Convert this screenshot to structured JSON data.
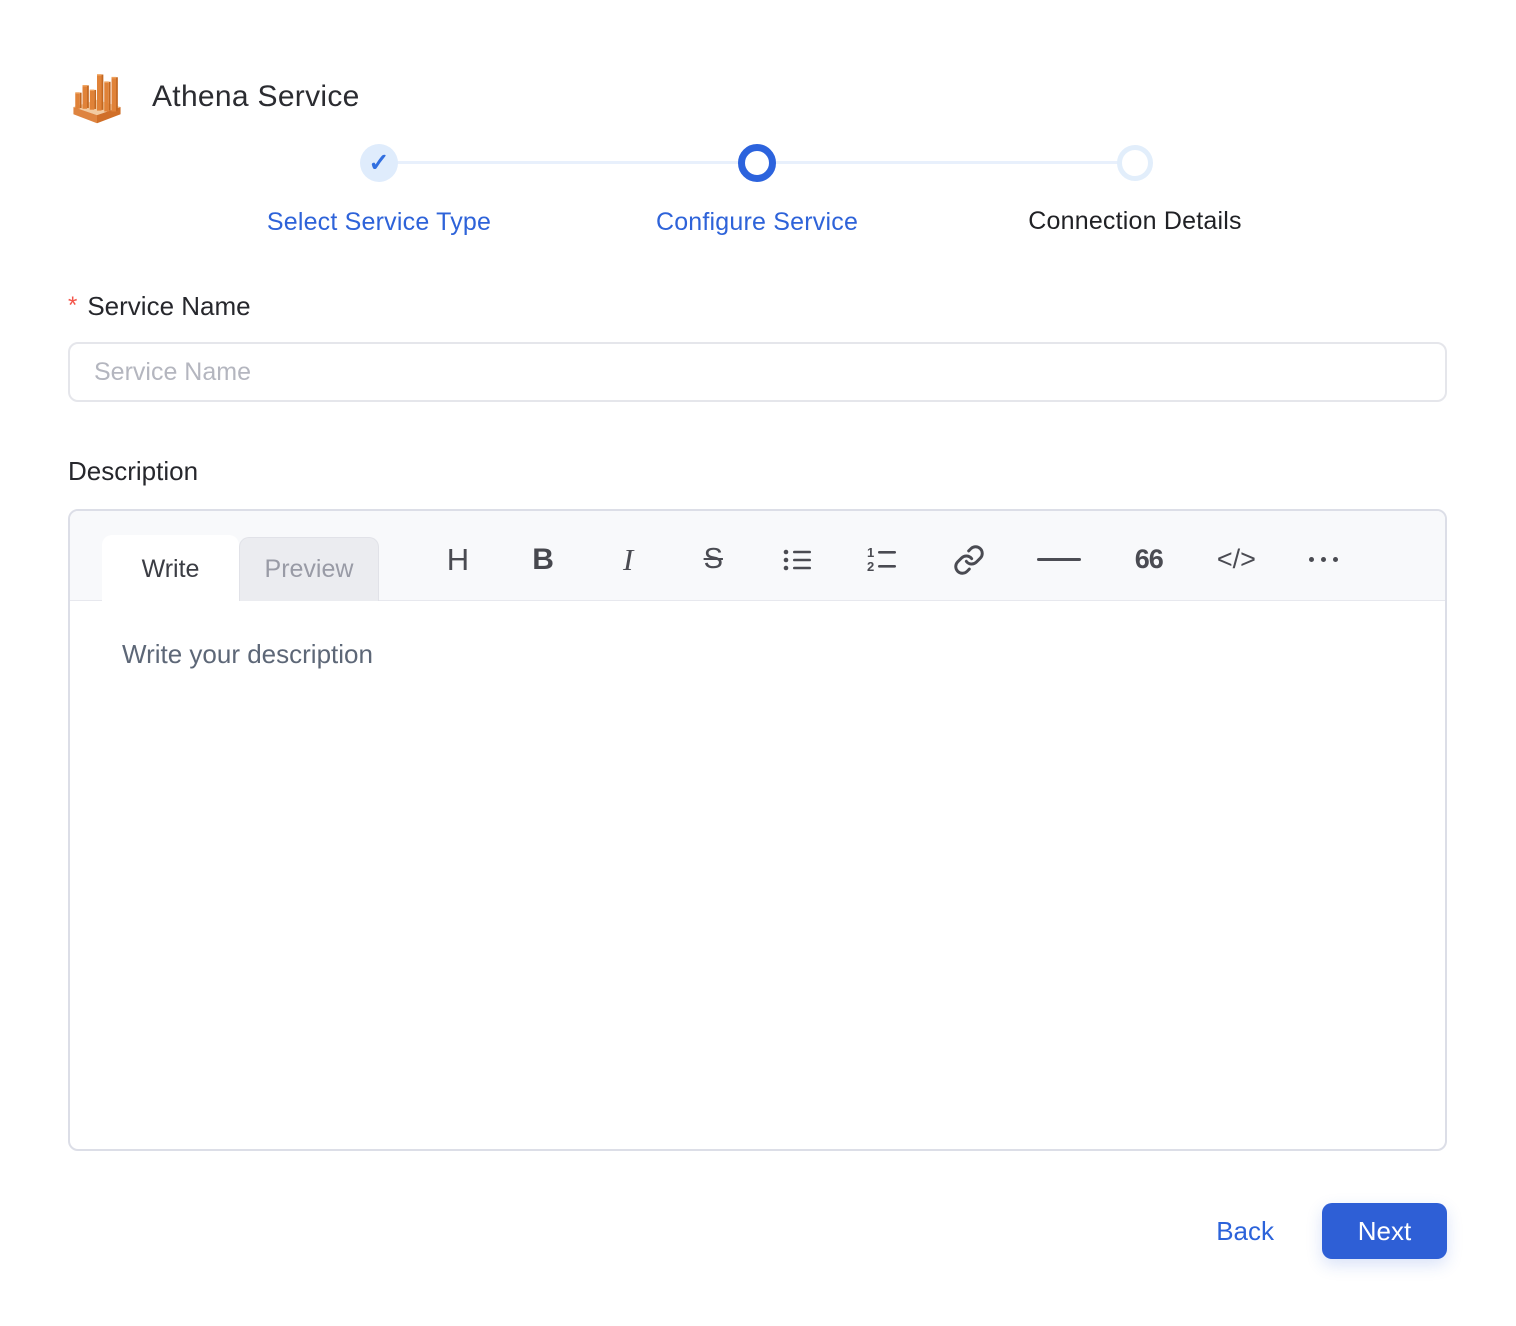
{
  "header": {
    "title": "Athena Service",
    "logo_icon": "athena-service-logo"
  },
  "stepper": {
    "check_glyph": "✓",
    "steps": [
      {
        "label": "Select Service Type",
        "state": "completed"
      },
      {
        "label": "Configure Service",
        "state": "current"
      },
      {
        "label": "Connection Details",
        "state": "upcoming"
      }
    ]
  },
  "form": {
    "service_name": {
      "label": "Service Name",
      "required_marker": "*",
      "placeholder": "Service Name",
      "value": ""
    },
    "description": {
      "label": "Description",
      "placeholder": "Write your description",
      "value": "",
      "editor": {
        "tabs": [
          {
            "label": "Write",
            "active": true
          },
          {
            "label": "Preview",
            "active": false
          }
        ],
        "toolbar": {
          "heading_glyph": "H",
          "bold_glyph": "B",
          "italic_glyph": "I",
          "strikethrough_glyph": "S",
          "quote_glyph": "66",
          "code_glyph": "</>",
          "icons": [
            "heading-icon",
            "bold-icon",
            "italic-icon",
            "strikethrough-icon",
            "bulleted-list-icon",
            "numbered-list-icon",
            "link-icon",
            "horizontal-rule-icon",
            "quote-icon",
            "code-icon",
            "more-icon"
          ]
        }
      }
    }
  },
  "footer": {
    "back_label": "Back",
    "next_label": "Next"
  },
  "colors": {
    "primary_blue": "#2e62d9",
    "completed_dot_bg": "#dfecfc",
    "current_ring": "#2c63dd",
    "upcoming_ring": "#e2eefb",
    "connector": "#e8f0fc",
    "required_red": "#f4564b",
    "logo_orange": "#e08238",
    "editor_header_bg": "#f8f9fb",
    "next_button_bg": "#2e5fd6"
  }
}
